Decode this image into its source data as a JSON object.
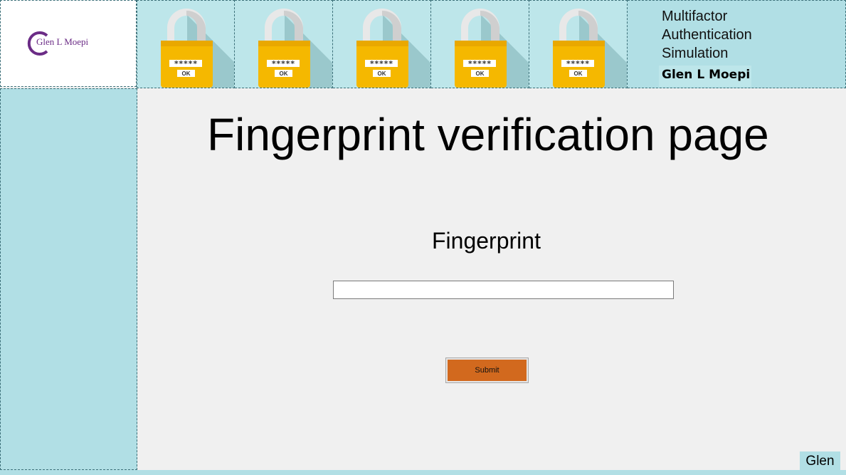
{
  "header": {
    "logo_text": "Glen L Moepi",
    "title_lines": [
      "Multifactor",
      "Authentication",
      "Simulation"
    ],
    "author": "Glen L Moepi",
    "locks": [
      {
        "password_mask": "*****",
        "ok_label": "OK"
      },
      {
        "password_mask": "*****",
        "ok_label": "OK"
      },
      {
        "password_mask": "*****",
        "ok_label": "OK"
      },
      {
        "password_mask": "*****",
        "ok_label": "OK"
      },
      {
        "password_mask": "*****",
        "ok_label": "OK"
      }
    ]
  },
  "main": {
    "page_title": "Fingerprint verification page",
    "field_label": "Fingerprint",
    "fingerprint_value": "",
    "submit_label": "Submit"
  },
  "footer": {
    "user_label": "Glen"
  },
  "colors": {
    "banner_tile": "#bde6ea",
    "panel": "#b1dfe5",
    "lock_body": "#f5b800",
    "submit": "#d2691e",
    "logo": "#6b2c86"
  }
}
